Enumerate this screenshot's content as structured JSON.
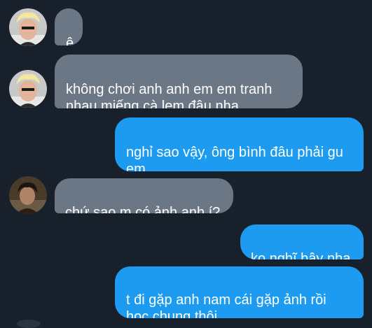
{
  "colors": {
    "background": "#17202b",
    "incoming_bubble": "#6c7785",
    "outgoing_bubble": "#1d9bf0",
    "text": "#ffffff"
  },
  "messages": [
    {
      "direction": "incoming",
      "sender_avatar": "blond-guy-photo",
      "text": "ê"
    },
    {
      "direction": "incoming",
      "sender_avatar": "blond-guy-photo",
      "text": "không chơi anh anh em em tranh\nnhau miếng cà lem đâu nha"
    },
    {
      "direction": "outgoing",
      "text": "nghỉ sao vậy, ông bình đâu phải gu\nem"
    },
    {
      "direction": "incoming",
      "sender_avatar": "dark-haired-person-photo",
      "text": "chứ sao m có ảnh anh í?"
    },
    {
      "direction": "outgoing",
      "text": "ko nghĩ bậy nha"
    },
    {
      "direction": "outgoing",
      "text": "t đi gặp anh nam cái gặp ảnh rồi\nhọc chung thôi"
    }
  ]
}
